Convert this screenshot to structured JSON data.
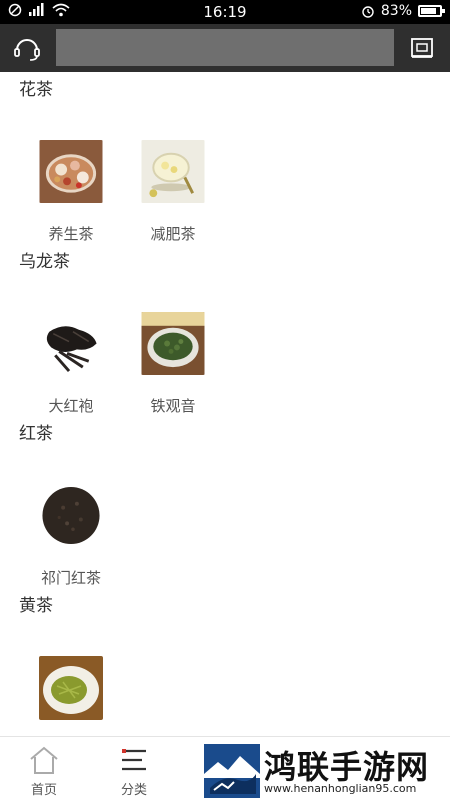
{
  "status_bar": {
    "time": "16:19",
    "battery": "83%",
    "battery_level": 0.83,
    "icons_left": [
      "dnd-icon",
      "signal-icon",
      "wifi-icon"
    ],
    "icons_right": [
      "alarm-icon",
      "battery-icon"
    ]
  },
  "top_bar": {
    "left_icon": "headset-icon",
    "right_icon": "scan-icon",
    "search_value": "",
    "search_placeholder": "",
    "background": "#2f2f2f"
  },
  "sections": [
    {
      "title": "花茶",
      "items": [
        {
          "label": "养生茶",
          "image": "herbal-tea"
        },
        {
          "label": "减肥茶",
          "image": "slimming-tea"
        }
      ]
    },
    {
      "title": "乌龙茶",
      "items": [
        {
          "label": "大红袍",
          "image": "dahongpao"
        },
        {
          "label": "铁观音",
          "image": "tieguanyin"
        }
      ]
    },
    {
      "title": "红茶",
      "items": [
        {
          "label": "祁门红茶",
          "image": "keemun"
        }
      ]
    },
    {
      "title": "黄茶",
      "items": [
        {
          "label": "",
          "image": "yellow-tea"
        }
      ]
    }
  ],
  "bottom_nav": [
    {
      "label": "首页",
      "icon": "home-icon"
    },
    {
      "label": "分类",
      "icon": "menu-icon"
    }
  ],
  "watermark": {
    "title": "鸿联手游网",
    "url": "www.henanhonglian95.com"
  }
}
